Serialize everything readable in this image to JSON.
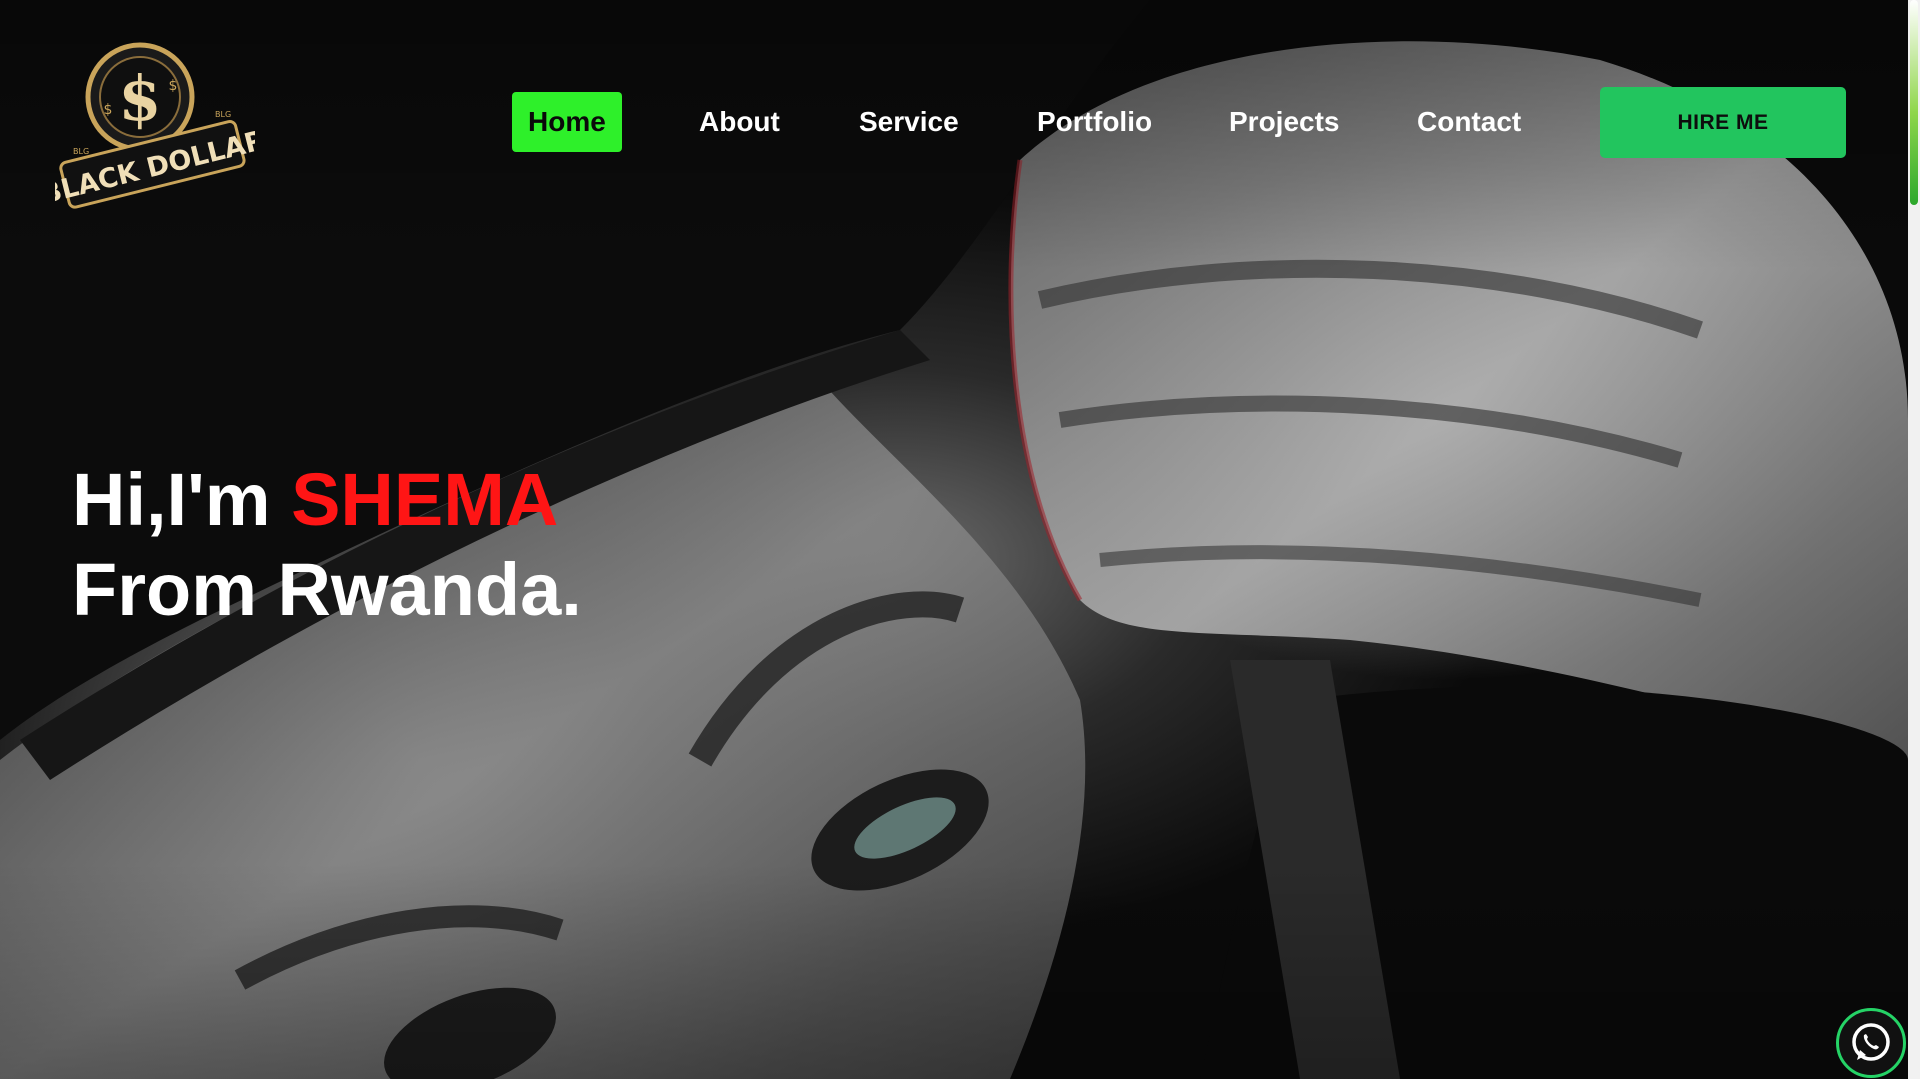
{
  "brand": {
    "logo_text": "BLACK DOLLAR",
    "logo_small": "BLG",
    "logo_symbol": "$",
    "logo_colors": {
      "gold": "#c9a45a",
      "dark": "#1a1a1a"
    }
  },
  "nav": {
    "items": [
      {
        "label": "Home",
        "active": true
      },
      {
        "label": "About",
        "active": false
      },
      {
        "label": "Service",
        "active": false
      },
      {
        "label": "Portfolio",
        "active": false
      },
      {
        "label": "Projects",
        "active": false
      },
      {
        "label": "Contact",
        "active": false
      }
    ],
    "active_color": "#2ef02a"
  },
  "header": {
    "hire_label": "HIRE ME",
    "hire_color": "#22c55e"
  },
  "hero": {
    "greeting": "Hi,I'm ",
    "name": "SHEMA",
    "line2": "From Rwanda.",
    "name_color": "#ff1515"
  },
  "floating": {
    "whatsapp_icon": "whatsapp-icon"
  }
}
